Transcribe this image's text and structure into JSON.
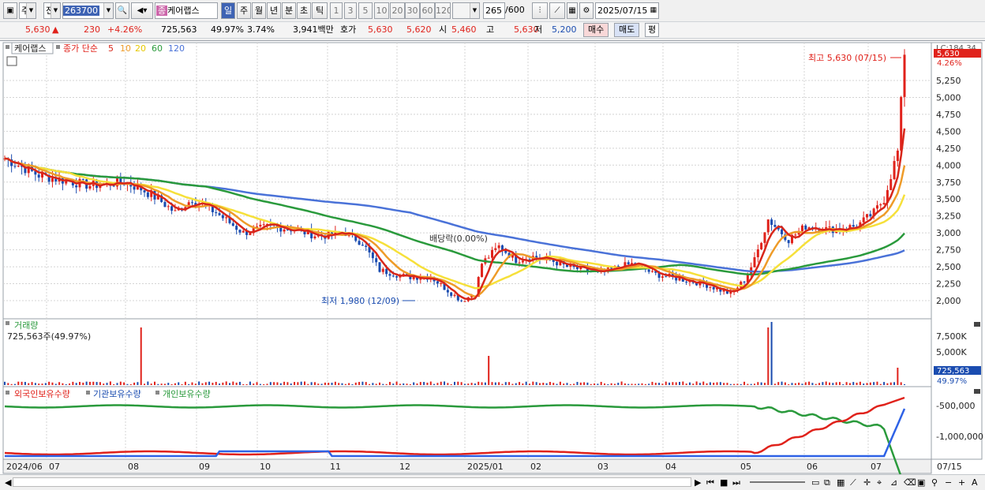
{
  "toolbar": {
    "period": "주",
    "market": "전",
    "code": "263700",
    "search_icon": "search-icon",
    "speaker_icon": "speaker-icon",
    "name_tag": "종",
    "name": "케어랩스",
    "periods": [
      "일",
      "주",
      "월",
      "년",
      "분",
      "초",
      "틱"
    ],
    "active_period": "일",
    "intervals": [
      "1",
      "3",
      "5",
      "10",
      "20",
      "30",
      "60",
      "120"
    ],
    "count": "265",
    "total": "/600",
    "date": "2025/07/15"
  },
  "quote": {
    "price": "5,630",
    "arrow": "▲",
    "change": "230",
    "pct": "+4.26%",
    "volume": "725,563",
    "vol_ratio": "49.97%",
    "turnover_pct": "3.74%",
    "amount": "3,941백만",
    "hoga_label": "호가",
    "hoga": "5,630",
    "hoga2": "5,620",
    "open_label": "시",
    "open": "5,460",
    "high_label": "고",
    "high": "5,630",
    "low_label": "저",
    "low": "5,200",
    "buy": "매수",
    "sell": "매도",
    "avg": "평"
  },
  "legend": {
    "name": "케어랩스",
    "ma_label": "종가 단순",
    "ma": [
      "5",
      "10",
      "20",
      "60",
      "120"
    ]
  },
  "colors": {
    "up": "#e0221b",
    "down": "#1a4cb0",
    "ma5": "#d8261a",
    "ma10": "#ee9b28",
    "ma20": "#f6e03a",
    "ma60": "#2a9a3c",
    "ma120": "#4a72d8"
  },
  "annotations": {
    "high": "최고 5,630 (07/15)",
    "low": "최저 1,980 (12/09)",
    "dividend": "배당락(0.00%)"
  },
  "price_axis": {
    "top": "LC:184.34",
    "current": "5,630",
    "change": "4.26%",
    "ticks": [
      "5,250",
      "5,000",
      "4,750",
      "4,500",
      "4,250",
      "4,000",
      "3,750",
      "3,500",
      "3,250",
      "3,000",
      "2,750",
      "2,500",
      "2,250",
      "2,000"
    ]
  },
  "volume_panel": {
    "title": "거래량",
    "value": "725,563주(49.97%)",
    "ticks": [
      "7,500K",
      "5,000K"
    ],
    "current": "725,563",
    "pct": "49.97%"
  },
  "holding_panel": {
    "series": [
      "외국인보유수량",
      "기관보유수량",
      "개인보유수량"
    ],
    "ticks": [
      "-500,000",
      "-1,000,000"
    ]
  },
  "time_axis": {
    "labels": [
      "2024/06",
      "07",
      "08",
      "09",
      "10",
      "11",
      "12",
      "2025/01",
      "02",
      "03",
      "04",
      "05",
      "06",
      "07"
    ],
    "last": "07/15"
  }
}
